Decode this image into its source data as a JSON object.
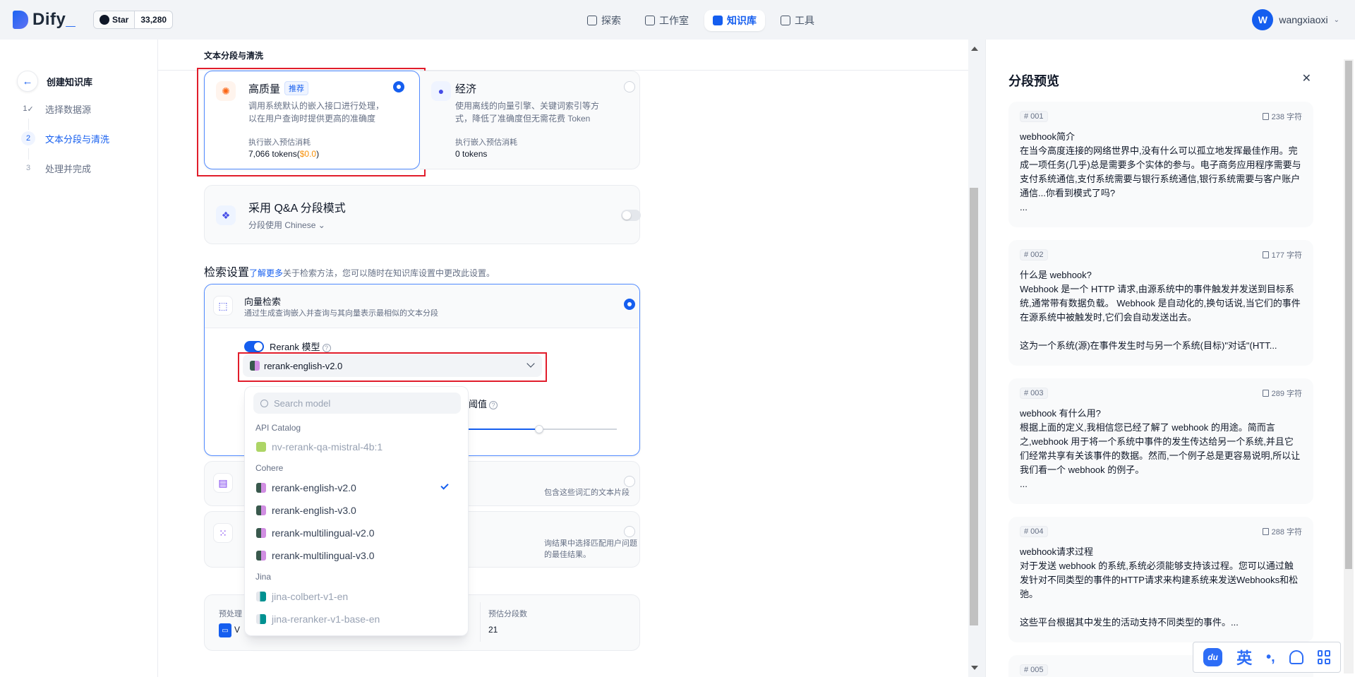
{
  "brand": {
    "name": "Dify",
    "github_label": "Star",
    "github_count": "33,280"
  },
  "nav": [
    {
      "label": "探索",
      "active": false,
      "icon": "explore-icon"
    },
    {
      "label": "工作室",
      "active": false,
      "icon": "studio-icon"
    },
    {
      "label": "知识库",
      "active": true,
      "icon": "knowledge-icon"
    },
    {
      "label": "工具",
      "active": false,
      "icon": "tools-icon"
    }
  ],
  "user": {
    "initial": "W",
    "name": "wangxiaoxi"
  },
  "steps": {
    "back_label": "创建知识库",
    "items": [
      {
        "num": "1",
        "label": "选择数据源",
        "state": "done"
      },
      {
        "num": "2",
        "label": "文本分段与清洗",
        "state": "active"
      },
      {
        "num": "3",
        "label": "处理并完成",
        "state": "todo"
      }
    ]
  },
  "main": {
    "section_title": "文本分段与清洗",
    "index_modes": {
      "high_quality": {
        "title": "高质量",
        "tag": "推荐",
        "desc1": "调用系统默认的嵌入接口进行处理，",
        "desc2": "以在用户查询时提供更高的准确度",
        "cost_label": "执行嵌入预估消耗",
        "cost_value": "7,066 tokens(",
        "cost_price": "$0.0",
        "cost_close": ")"
      },
      "economy": {
        "title": "经济",
        "desc1": "使用离线的向量引擎、关键词索引等方",
        "desc2": "式，降低了准确度但无需花费 Token",
        "cost_label": "执行嵌入预估消耗",
        "cost_value": "0 tokens"
      }
    },
    "qa": {
      "title": "采用 Q&A 分段模式",
      "lang_label": "分段使用 Chinese"
    },
    "retrieval": {
      "title": "检索设置",
      "link": "了解更多",
      "desc": "关于检索方法，您可以随时在知识库设置中更改此设置。",
      "vector": {
        "title": "向量检索",
        "desc": "通过生成查询嵌入并查询与其向量表示最相似的文本分段"
      },
      "rerank_label": "Rerank 模型",
      "rerank_selected": "rerank-english-v2.0",
      "threshold_label": "阈值",
      "fulltext_desc_partial": "包含这些词汇的文本片段",
      "hybrid_desc_partial": "询结果中选择匹配用户问题的最佳结果。"
    },
    "summary": {
      "left_label_partial": "预处理",
      "left_value_partial": "V",
      "count_label": "预估分段数",
      "count_value": "21"
    }
  },
  "dropdown": {
    "search_placeholder": "Search model",
    "groups": [
      {
        "name": "API Catalog",
        "items": [
          {
            "label": "nv-rerank-qa-mistral-4b:1",
            "dim": true,
            "logo": "nvidia"
          }
        ]
      },
      {
        "name": "Cohere",
        "items": [
          {
            "label": "rerank-english-v2.0",
            "selected": true,
            "logo": "cohere"
          },
          {
            "label": "rerank-english-v3.0",
            "logo": "cohere"
          },
          {
            "label": "rerank-multilingual-v2.0",
            "logo": "cohere"
          },
          {
            "label": "rerank-multilingual-v3.0",
            "logo": "cohere"
          }
        ]
      },
      {
        "name": "Jina",
        "items": [
          {
            "label": "jina-colbert-v1-en",
            "dim": true,
            "logo": "jina"
          },
          {
            "label": "jina-reranker-v1-base-en",
            "dim": true,
            "logo": "jina"
          }
        ]
      }
    ]
  },
  "preview": {
    "title": "分段预览",
    "chunks": [
      {
        "id": "# 001",
        "count": "238 字符",
        "text": "webhook简介\n在当今高度连接的网络世界中,没有什么可以孤立地发挥最佳作用。完成一项任务(几乎)总是需要多个实体的参与。电子商务应用程序需要与支付系统通信,支付系统需要与银行系统通信,银行系统需要与客户账户通信...你看到模式了吗?\n..."
      },
      {
        "id": "# 002",
        "count": "177 字符",
        "text": "什么是 webhook?\nWebhook 是一个 HTTP 请求,由源系统中的事件触发并发送到目标系统,通常带有数据负载。 Webhook 是自动化的,换句话说,当它们的事件在源系统中被触发时,它们会自动发送出去。\n\n这为一个系统(源)在事件发生时与另一个系统(目标)\"对话\"(HTT..."
      },
      {
        "id": "# 003",
        "count": "289 字符",
        "text": "webhook 有什么用?\n根据上面的定义,我相信您已经了解了 webhook 的用途。简而言之,webhook 用于将一个系统中事件的发生传达给另一个系统,并且它们经常共享有关该事件的数据。然而,一个例子总是更容易说明,所以让我们看一个 webhook 的例子。\n..."
      },
      {
        "id": "# 004",
        "count": "288 字符",
        "text": "webhook请求过程\n对于发送 webhook 的系统,系统必须能够支持该过程。您可以通过触发针对不同类型的事件的HTTP请求来构建系统来发送Webhooks和松弛。\n\n这些平台根据其中发生的活动支持不同类型的事件。..."
      },
      {
        "id": "# 005",
        "count": ""
      }
    ]
  },
  "ime": {
    "logo": "du",
    "lang": "英",
    "punct": "•,"
  },
  "colors": {
    "accent": "#155eef",
    "highlight_red": "#e11d2b",
    "price": "#f79009"
  }
}
